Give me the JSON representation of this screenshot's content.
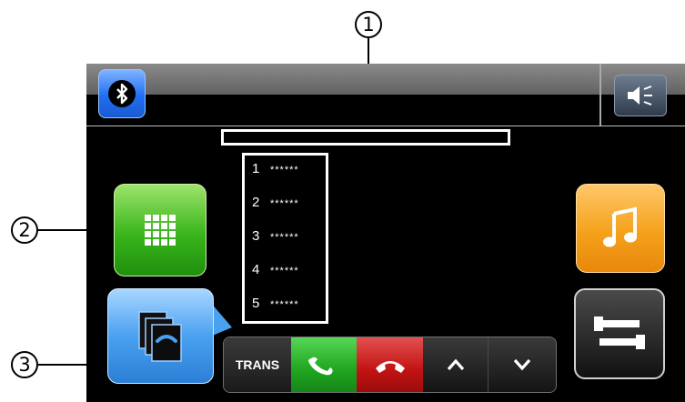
{
  "callouts": {
    "c1": "1",
    "c2": "2",
    "c3": "3"
  },
  "topbar": {
    "bluetooth_icon": "bluetooth-icon",
    "speaker_icon": "speaker-volume-icon"
  },
  "contact_name_field": {
    "value": ""
  },
  "call_list": {
    "items": [
      {
        "num": "1",
        "value": "******"
      },
      {
        "num": "2",
        "value": "******"
      },
      {
        "num": "3",
        "value": "******"
      },
      {
        "num": "4",
        "value": "******"
      },
      {
        "num": "5",
        "value": "******"
      }
    ]
  },
  "side_buttons": {
    "dialpad_icon": "dialpad-icon",
    "phonebook_icon": "phonebook-icon",
    "music_icon": "music-note-icon",
    "settings_icon": "wrench-icon"
  },
  "call_bar": {
    "trans_label": "TRANS",
    "answer_icon": "answer-call-icon",
    "hangup_icon": "hang-up-icon",
    "up_icon": "chevron-up-icon",
    "down_icon": "chevron-down-icon"
  },
  "colors": {
    "answer": "#1fa61f",
    "hangup": "#c21313",
    "bluetooth": "#1f6ff2",
    "dialpad": "#39b51b",
    "phonebook": "#4aa1f0",
    "music": "#f5a11b"
  }
}
